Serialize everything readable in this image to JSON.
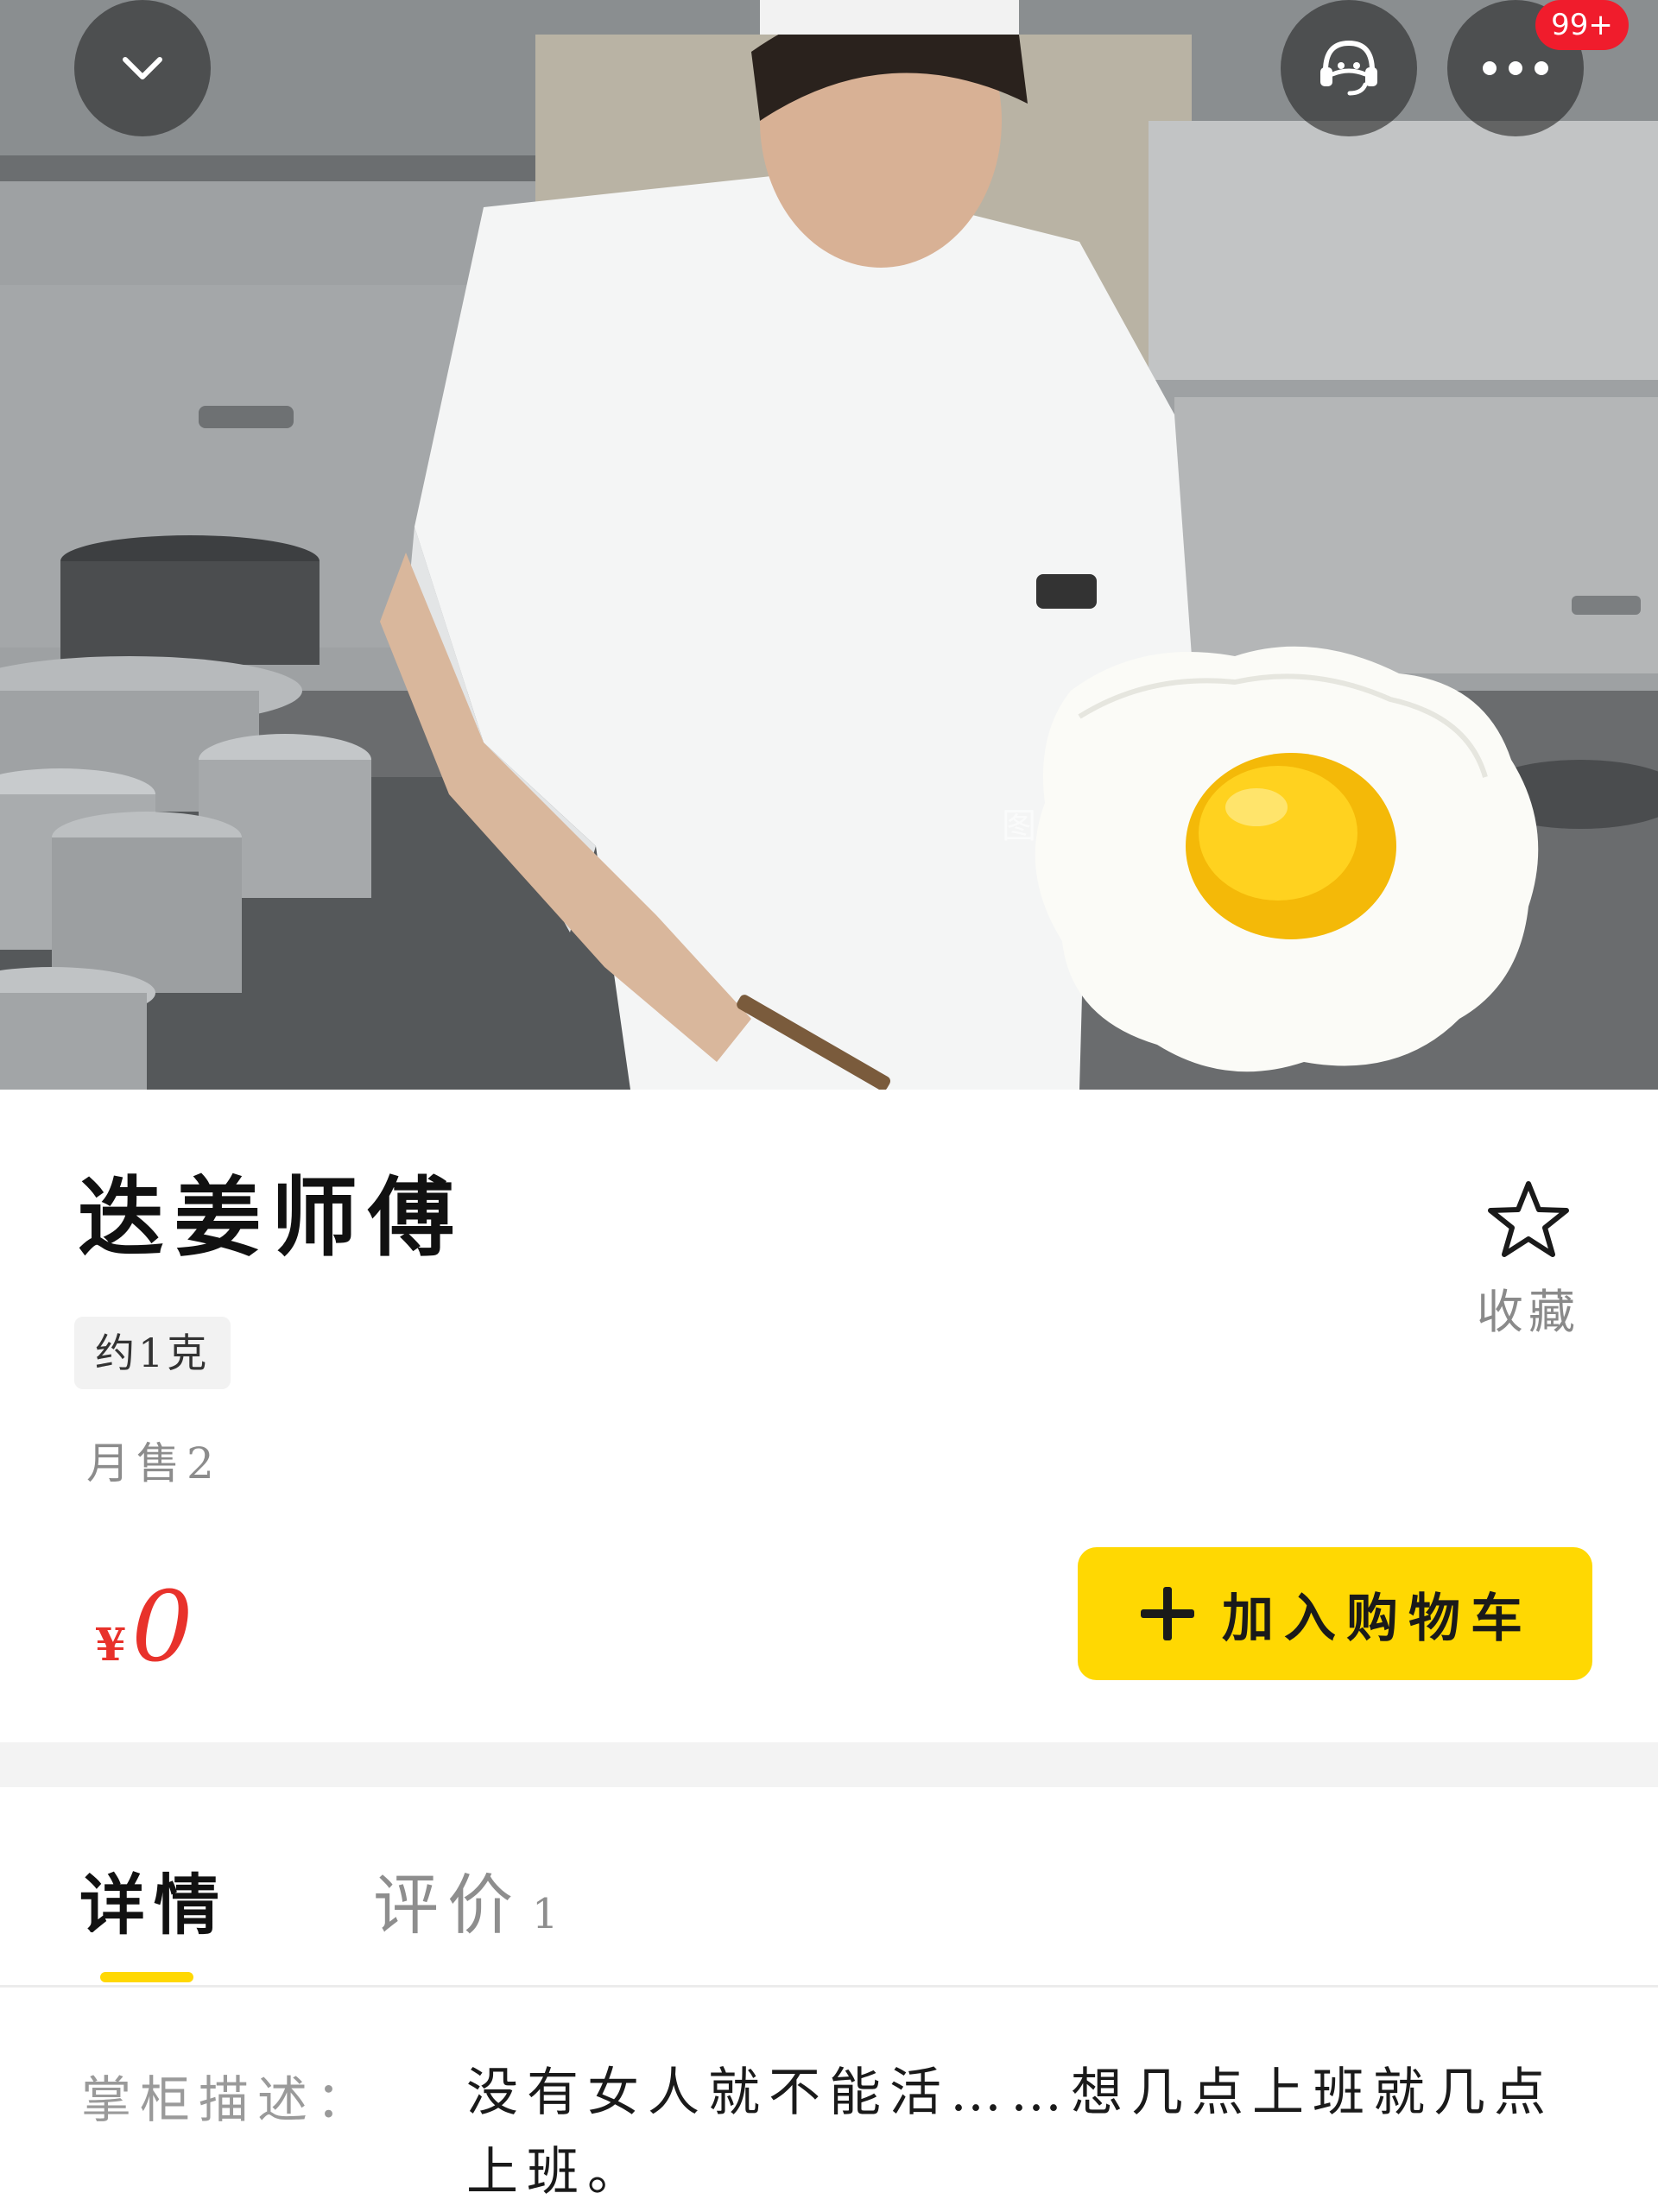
{
  "header": {
    "notification_badge": "99+",
    "back_icon": "chevron-down-icon",
    "service_icon": "customer-service-icon",
    "more_icon": "more-dots-icon"
  },
  "hero": {
    "watermark": "图片"
  },
  "product": {
    "title": "迭姜师傅",
    "spec": "约1克",
    "monthly_sales": "月售2",
    "price_currency": "¥",
    "price_amount": "0",
    "favorite_label": "收藏",
    "add_to_cart_label": "加入购物车"
  },
  "tabs": [
    {
      "label": "详情",
      "active": true
    },
    {
      "label": "评价",
      "count": "1",
      "active": false
    }
  ],
  "description": {
    "label": "掌柜描述：",
    "text": "没有女人就不能活……想几点上班就几点上班。"
  },
  "colors": {
    "accent_yellow": "#ffd802",
    "price_red": "#e8322b",
    "badge_red": "#f01c2c"
  }
}
